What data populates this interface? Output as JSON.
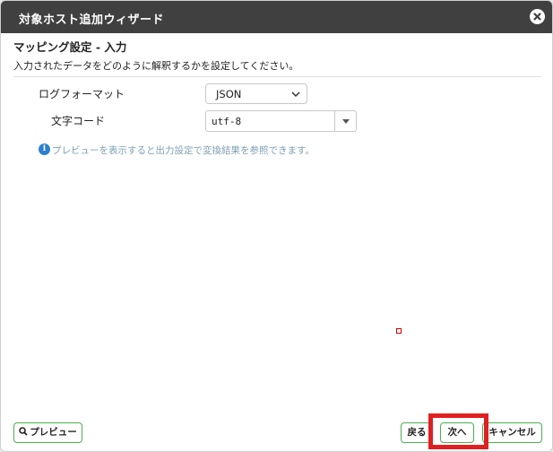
{
  "dialog": {
    "title": "対象ホスト追加ウィザード",
    "section_title": "マッピング設定 - 入力",
    "description": "入力されたデータをどのように解釈するかを設定してください。"
  },
  "form": {
    "log_format_label": "ログフォーマット",
    "log_format_value": "JSON",
    "charset_label": "文字コード",
    "charset_value": "utf-8"
  },
  "info": {
    "icon": "i",
    "text": "プレビューを表示すると出力設定で変換結果を参照できます。"
  },
  "footer": {
    "preview_label": "プレビュー",
    "back_label": "戻る",
    "next_label": "次へ",
    "cancel_label": "キャンセル"
  },
  "colors": {
    "titlebar": "#404040",
    "button_border": "#4caf50",
    "info_icon": "#2d7fd0",
    "highlight": "#e02020"
  }
}
